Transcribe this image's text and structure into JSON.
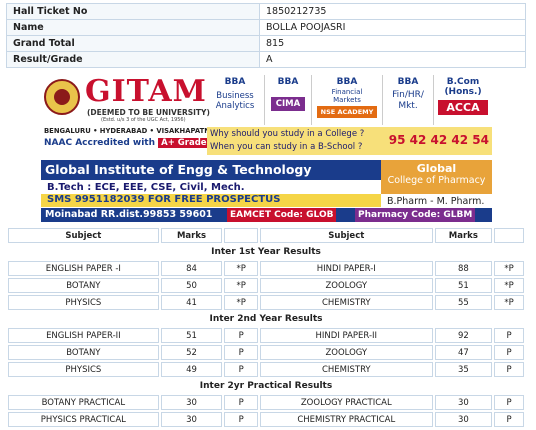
{
  "student": {
    "rows": [
      {
        "label": "Hall Ticket No",
        "value": "1850212735"
      },
      {
        "label": "Name",
        "value": "BOLLA POOJASRI"
      },
      {
        "label": "Grand Total",
        "value": "815"
      },
      {
        "label": "Result/Grade",
        "value": "A"
      }
    ]
  },
  "ad_gitam": {
    "name": "GITAM",
    "tag": "(DEEMED TO BE UNIVERSITY)",
    "sub": "(Estd. u/s 3 of the UGC Act, 1956)",
    "cities": "BENGALURU • HYDERABAD • VISAKHAPATNAM",
    "naac": "NAAC Accredited with",
    "grade": "A+ Grade",
    "bba1": "BBA",
    "bba1_sub": "Business Analytics",
    "bba2": "BBA",
    "cima": "CIMA",
    "bba3": "BBA",
    "bba3_sub": "Financial Markets",
    "nse": "NSE ACADEMY",
    "bba4": "BBA",
    "bba4_sub": "Fin/HR/ Mkt.",
    "bcom": "B.Com",
    "bcom_sub": "(Hons.)",
    "acca": "ACCA",
    "q1": "Why should you study in a College ?",
    "q2": "When you can study in a B-School ?",
    "phone": "95 42 42 42 54"
  },
  "ad_global": {
    "title": "Global Institute of Engg & Technology",
    "pharm1": "Global",
    "pharm2": "College of Pharmacy",
    "btech": "B.Tech : ECE, EEE, CSE, Civil, Mech.",
    "sms": "SMS 9951182039 FOR FREE PROSPECTUS",
    "bpharm": "B.Pharm - M. Pharm.",
    "addr": "Moinabad RR.dist.99853 59601",
    "eamcet": "EAMCET Code: GLOB",
    "pcode": "Pharmacy Code: GLBM"
  },
  "results": {
    "headers": {
      "subject": "Subject",
      "marks": "Marks"
    },
    "sections": [
      {
        "title": "Inter 1st Year Results",
        "rows": [
          [
            "ENGLISH PAPER -I",
            "84",
            "*P",
            "HINDI PAPER-I",
            "88",
            "*P"
          ],
          [
            "BOTANY",
            "50",
            "*P",
            "ZOOLOGY",
            "51",
            "*P"
          ],
          [
            "PHYSICS",
            "41",
            "*P",
            "CHEMISTRY",
            "55",
            "*P"
          ]
        ]
      },
      {
        "title": "Inter 2nd Year Results",
        "rows": [
          [
            "ENGLISH PAPER-II",
            "51",
            "P",
            "HINDI PAPER-II",
            "92",
            "P"
          ],
          [
            "BOTANY",
            "52",
            "P",
            "ZOOLOGY",
            "47",
            "P"
          ],
          [
            "PHYSICS",
            "49",
            "P",
            "CHEMISTRY",
            "35",
            "P"
          ]
        ]
      },
      {
        "title": "Inter 2yr Practical Results",
        "rows": [
          [
            "BOTANY PRACTICAL",
            "30",
            "P",
            "ZOOLOGY PRACTICAL",
            "30",
            "P"
          ],
          [
            "PHYSICS PRACTICAL",
            "30",
            "P",
            "CHEMISTRY PRACTICAL",
            "30",
            "P"
          ]
        ]
      }
    ]
  }
}
